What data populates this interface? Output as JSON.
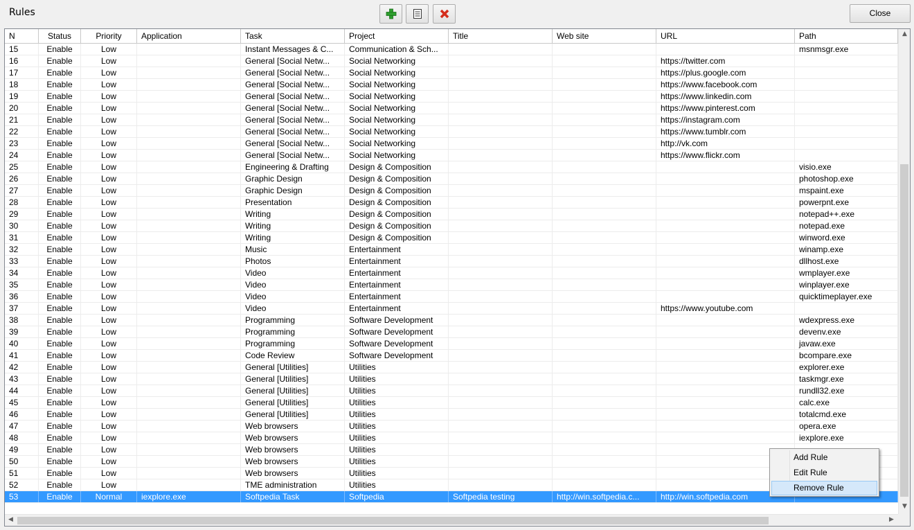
{
  "window": {
    "title": "Rules"
  },
  "toolbar": {
    "add": {
      "icon": "plus-icon",
      "color": "#2e9e2e"
    },
    "edit": {
      "icon": "list-icon",
      "color": "#3a3a3a"
    },
    "delete": {
      "icon": "x-icon",
      "color": "#d42d1c"
    },
    "close_label": "Close"
  },
  "columns": [
    "N",
    "Status",
    "Priority",
    "Application",
    "Task",
    "Project",
    "Title",
    "Web site",
    "URL",
    "Path"
  ],
  "rows": [
    [
      "15",
      "Enable",
      "Low",
      "",
      "Instant Messages & C...",
      "Communication & Sch...",
      "",
      "",
      "",
      "msnmsgr.exe"
    ],
    [
      "16",
      "Enable",
      "Low",
      "",
      "General [Social Netw...",
      "Social Networking",
      "",
      "",
      "https://twitter.com",
      ""
    ],
    [
      "17",
      "Enable",
      "Low",
      "",
      "General [Social Netw...",
      "Social Networking",
      "",
      "",
      "https://plus.google.com",
      ""
    ],
    [
      "18",
      "Enable",
      "Low",
      "",
      "General [Social Netw...",
      "Social Networking",
      "",
      "",
      "https://www.facebook.com",
      ""
    ],
    [
      "19",
      "Enable",
      "Low",
      "",
      "General [Social Netw...",
      "Social Networking",
      "",
      "",
      "https://www.linkedin.com",
      ""
    ],
    [
      "20",
      "Enable",
      "Low",
      "",
      "General [Social Netw...",
      "Social Networking",
      "",
      "",
      "https://www.pinterest.com",
      ""
    ],
    [
      "21",
      "Enable",
      "Low",
      "",
      "General [Social Netw...",
      "Social Networking",
      "",
      "",
      "https://instagram.com",
      ""
    ],
    [
      "22",
      "Enable",
      "Low",
      "",
      "General [Social Netw...",
      "Social Networking",
      "",
      "",
      "https://www.tumblr.com",
      ""
    ],
    [
      "23",
      "Enable",
      "Low",
      "",
      "General [Social Netw...",
      "Social Networking",
      "",
      "",
      "http://vk.com",
      ""
    ],
    [
      "24",
      "Enable",
      "Low",
      "",
      "General [Social Netw...",
      "Social Networking",
      "",
      "",
      "https://www.flickr.com",
      ""
    ],
    [
      "25",
      "Enable",
      "Low",
      "",
      "Engineering & Drafting",
      "Design & Composition",
      "",
      "",
      "",
      "visio.exe"
    ],
    [
      "26",
      "Enable",
      "Low",
      "",
      "Graphic Design",
      "Design & Composition",
      "",
      "",
      "",
      "photoshop.exe"
    ],
    [
      "27",
      "Enable",
      "Low",
      "",
      "Graphic Design",
      "Design & Composition",
      "",
      "",
      "",
      "mspaint.exe"
    ],
    [
      "28",
      "Enable",
      "Low",
      "",
      "Presentation",
      "Design & Composition",
      "",
      "",
      "",
      "powerpnt.exe"
    ],
    [
      "29",
      "Enable",
      "Low",
      "",
      "Writing",
      "Design & Composition",
      "",
      "",
      "",
      "notepad++.exe"
    ],
    [
      "30",
      "Enable",
      "Low",
      "",
      "Writing",
      "Design & Composition",
      "",
      "",
      "",
      "notepad.exe"
    ],
    [
      "31",
      "Enable",
      "Low",
      "",
      "Writing",
      "Design & Composition",
      "",
      "",
      "",
      "winword.exe"
    ],
    [
      "32",
      "Enable",
      "Low",
      "",
      "Music",
      "Entertainment",
      "",
      "",
      "",
      "winamp.exe"
    ],
    [
      "33",
      "Enable",
      "Low",
      "",
      "Photos",
      "Entertainment",
      "",
      "",
      "",
      "dllhost.exe"
    ],
    [
      "34",
      "Enable",
      "Low",
      "",
      "Video",
      "Entertainment",
      "",
      "",
      "",
      "wmplayer.exe"
    ],
    [
      "35",
      "Enable",
      "Low",
      "",
      "Video",
      "Entertainment",
      "",
      "",
      "",
      "winplayer.exe"
    ],
    [
      "36",
      "Enable",
      "Low",
      "",
      "Video",
      "Entertainment",
      "",
      "",
      "",
      "quicktimeplayer.exe"
    ],
    [
      "37",
      "Enable",
      "Low",
      "",
      "Video",
      "Entertainment",
      "",
      "",
      "https://www.youtube.com",
      ""
    ],
    [
      "38",
      "Enable",
      "Low",
      "",
      "Programming",
      "Software Development",
      "",
      "",
      "",
      "wdexpress.exe"
    ],
    [
      "39",
      "Enable",
      "Low",
      "",
      "Programming",
      "Software Development",
      "",
      "",
      "",
      "devenv.exe"
    ],
    [
      "40",
      "Enable",
      "Low",
      "",
      "Programming",
      "Software Development",
      "",
      "",
      "",
      "javaw.exe"
    ],
    [
      "41",
      "Enable",
      "Low",
      "",
      "Code Review",
      "Software Development",
      "",
      "",
      "",
      "bcompare.exe"
    ],
    [
      "42",
      "Enable",
      "Low",
      "",
      "General [Utilities]",
      "Utilities",
      "",
      "",
      "",
      "explorer.exe"
    ],
    [
      "43",
      "Enable",
      "Low",
      "",
      "General [Utilities]",
      "Utilities",
      "",
      "",
      "",
      "taskmgr.exe"
    ],
    [
      "44",
      "Enable",
      "Low",
      "",
      "General [Utilities]",
      "Utilities",
      "",
      "",
      "",
      "rundll32.exe"
    ],
    [
      "45",
      "Enable",
      "Low",
      "",
      "General [Utilities]",
      "Utilities",
      "",
      "",
      "",
      "calc.exe"
    ],
    [
      "46",
      "Enable",
      "Low",
      "",
      "General [Utilities]",
      "Utilities",
      "",
      "",
      "",
      "totalcmd.exe"
    ],
    [
      "47",
      "Enable",
      "Low",
      "",
      "Web browsers",
      "Utilities",
      "",
      "",
      "",
      "opera.exe"
    ],
    [
      "48",
      "Enable",
      "Low",
      "",
      "Web browsers",
      "Utilities",
      "",
      "",
      "",
      "iexplore.exe"
    ],
    [
      "49",
      "Enable",
      "Low",
      "",
      "Web browsers",
      "Utilities",
      "",
      "",
      "",
      ""
    ],
    [
      "50",
      "Enable",
      "Low",
      "",
      "Web browsers",
      "Utilities",
      "",
      "",
      "",
      ""
    ],
    [
      "51",
      "Enable",
      "Low",
      "",
      "Web browsers",
      "Utilities",
      "",
      "",
      "",
      ""
    ],
    [
      "52",
      "Enable",
      "Low",
      "",
      "TME administration",
      "Utilities",
      "",
      "",
      "",
      ""
    ],
    [
      "53",
      "Enable",
      "Normal",
      "iexplore.exe",
      "Softpedia Task",
      "Softpedia",
      "Softpedia testing",
      "http://win.softpedia.c...",
      "http://win.softpedia.com",
      ""
    ]
  ],
  "selected_row": "53",
  "context_menu": {
    "items": [
      "Add Rule",
      "Edit Rule",
      "Remove Rule"
    ],
    "hovered": "Remove Rule"
  },
  "scrollbars": {
    "up_arrow": "up-arrow-icon",
    "down_arrow": "down-arrow-icon",
    "left_arrow": "left-arrow-icon",
    "right_arrow": "right-arrow-icon"
  },
  "colors": {
    "selection": "#3399ff",
    "menu_hover": "#d5e8fa"
  }
}
